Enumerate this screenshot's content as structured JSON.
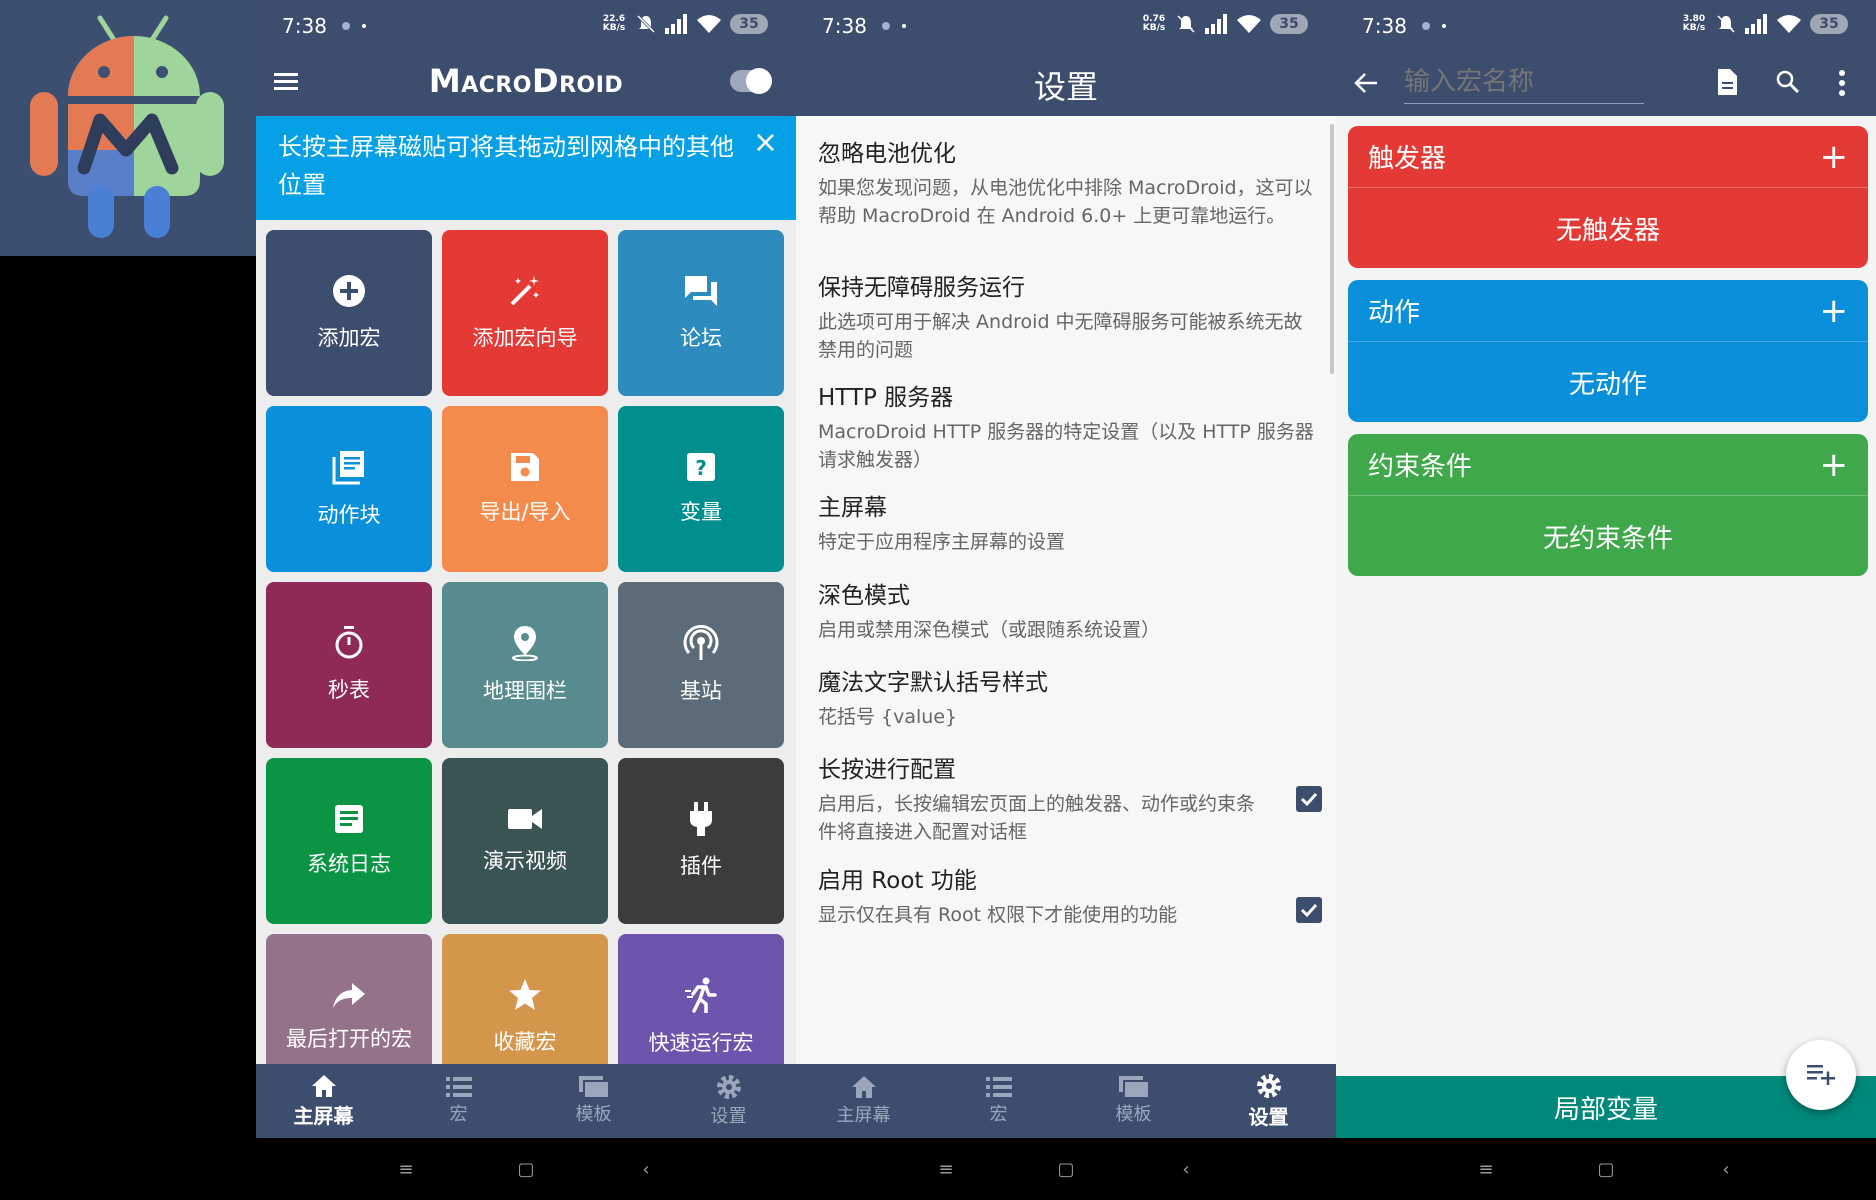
{
  "status_bar": {
    "time": "7:38",
    "speeds": [
      "22.6 KB/s",
      "0.76 KB/s",
      "3.80 KB/s"
    ],
    "battery": "35"
  },
  "nav": {
    "home": "主屏幕",
    "macros": "宏",
    "templates": "模板",
    "settings": "设置"
  },
  "home": {
    "app_title": "MacroDroid",
    "banner_text": "长按主屏幕磁贴可将其拖动到网格中的其他位置",
    "banner_close": "×",
    "tiles": [
      {
        "label": "添加宏",
        "icon": "add-circle-icon",
        "color": "#3d4d6e"
      },
      {
        "label": "添加宏向导",
        "icon": "magic-wand-icon",
        "color": "#e53935"
      },
      {
        "label": "论坛",
        "icon": "forum-icon",
        "color": "#2e8bbd"
      },
      {
        "label": "动作块",
        "icon": "library-books-icon",
        "color": "#0a8fdb"
      },
      {
        "label": "导出/导入",
        "icon": "save-icon",
        "color": "#f48a4c"
      },
      {
        "label": "变量",
        "icon": "help-box-icon",
        "color": "#008e8e"
      },
      {
        "label": "秒表",
        "icon": "timer-icon",
        "color": "#8e2a55"
      },
      {
        "label": "地理围栏",
        "icon": "location-pin-icon",
        "color": "#588b8d"
      },
      {
        "label": "基站",
        "icon": "cell-tower-icon",
        "color": "#5b6b78"
      },
      {
        "label": "系统日志",
        "icon": "log-document-icon",
        "color": "#0b9444"
      },
      {
        "label": "演示视频",
        "icon": "video-camera-icon",
        "color": "#3a5454"
      },
      {
        "label": "插件",
        "icon": "plug-icon",
        "color": "#3c3c3c"
      },
      {
        "label": "最后打开的宏",
        "icon": "share-arrow-icon",
        "color": "#94738a"
      },
      {
        "label": "收藏宏",
        "icon": "star-icon",
        "color": "#d3964a"
      },
      {
        "label": "快速运行宏",
        "icon": "running-person-icon",
        "color": "#6d55ae"
      }
    ]
  },
  "settings": {
    "title": "设置",
    "items": [
      {
        "title": "忽略电池优化",
        "desc": "如果您发现问题，从电池优化中排除 MacroDroid，这可以帮助 MacroDroid 在 Android 6.0+ 上更可靠地运行。",
        "checked": false
      },
      {
        "title": "保持无障碍服务运行",
        "desc": "此选项可用于解决 Android 中无障碍服务可能被系统无故禁用的问题",
        "checked": false
      },
      {
        "title": "HTTP 服务器",
        "desc": "MacroDroid HTTP 服务器的特定设置（以及 HTTP 服务器请求触发器）",
        "checked": false
      },
      {
        "title": "主屏幕",
        "desc": "特定于应用程序主屏幕的设置",
        "checked": false
      },
      {
        "title": "深色模式",
        "desc": "启用或禁用深色模式（或跟随系统设置）",
        "checked": false
      },
      {
        "title": "魔法文字默认括号样式",
        "desc": "花括号 {value}",
        "checked": false
      },
      {
        "title": "长按进行配置",
        "desc": "启用后，长按编辑宏页面上的触发器、动作或约束条件将直接进入配置对话框",
        "checked": true
      },
      {
        "title": "启用 Root 功能",
        "desc": "显示仅在具有 Root 权限下才能使用的功能",
        "checked": true
      }
    ]
  },
  "editor": {
    "name_placeholder": "输入宏名称",
    "triggers": {
      "title": "触发器",
      "empty": "无触发器",
      "add": "+",
      "color": "#e53935"
    },
    "actions": {
      "title": "动作",
      "empty": "无动作",
      "add": "+",
      "color": "#0a8fdb"
    },
    "constraints": {
      "title": "约束条件",
      "empty": "无约束条件",
      "add": "+",
      "color": "#3fa84a"
    },
    "local_vars": "局部变量"
  }
}
